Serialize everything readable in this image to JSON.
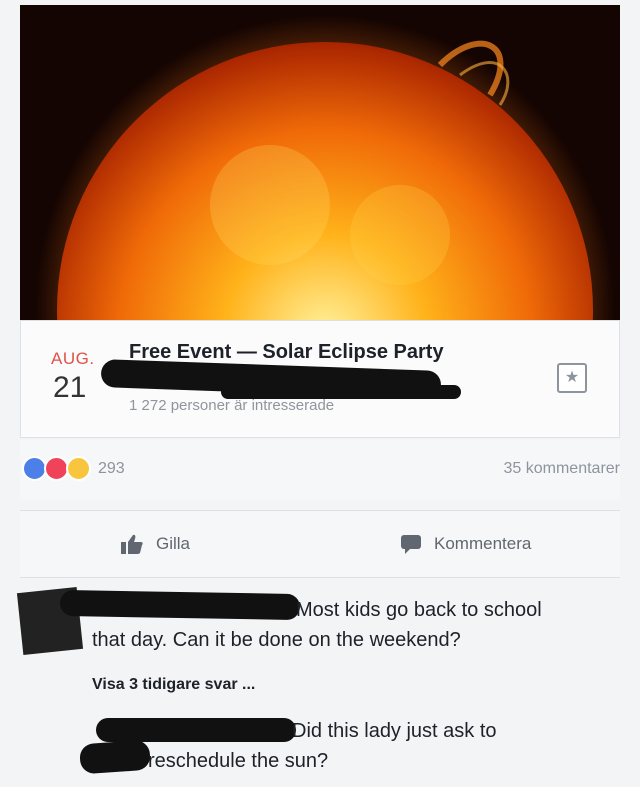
{
  "colors": {
    "accent_month": "#e0524a",
    "like_blue": "#4d7fe8",
    "love_red": "#f0435a",
    "wow_yellow": "#f7c63e"
  },
  "event": {
    "image_icon": "sun-photo",
    "date_month": "AUG.",
    "date_day": "21",
    "title": "Free Event — Solar Eclipse Party",
    "meta": "1 272 personer är intresserade",
    "save_icon": "star-icon"
  },
  "reactions": {
    "icons": [
      "like-icon",
      "love-icon",
      "wow-icon"
    ],
    "count": "293",
    "comments_count": "35 kommentarer"
  },
  "actions": {
    "like_label": "Gilla",
    "comment_label": "Kommentera"
  },
  "comments": [
    {
      "text_line1": "Most kids go back to school",
      "text_line2": "that day. Can it be done on the weekend?"
    }
  ],
  "view_replies": "Visa 3 tidigare svar ...",
  "replies": [
    {
      "text_line1": "Did this lady just ask to",
      "text_line2": "reschedule the sun?"
    }
  ]
}
